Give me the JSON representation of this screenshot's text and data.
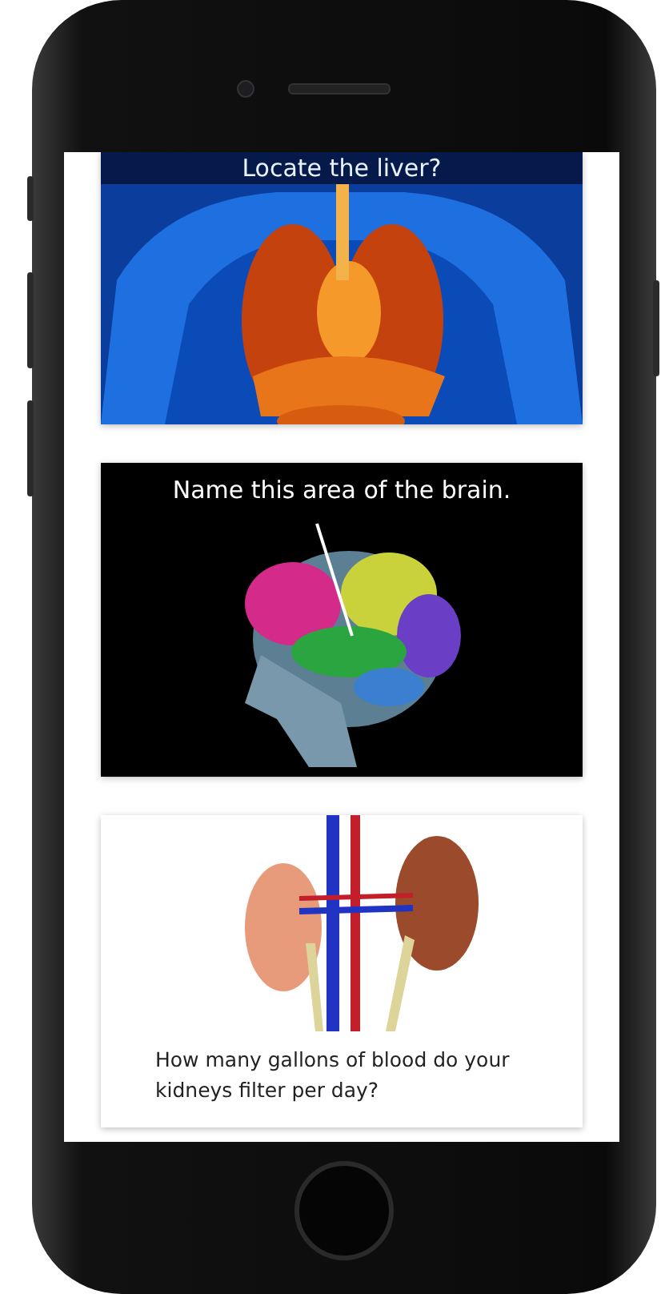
{
  "cards": [
    {
      "kind": "banner",
      "question": "Locate the liver?"
    },
    {
      "kind": "overlay",
      "question": "Name this area of the brain."
    },
    {
      "kind": "below",
      "question": "How many gallons of blood do your kidneys filter per day?"
    }
  ]
}
